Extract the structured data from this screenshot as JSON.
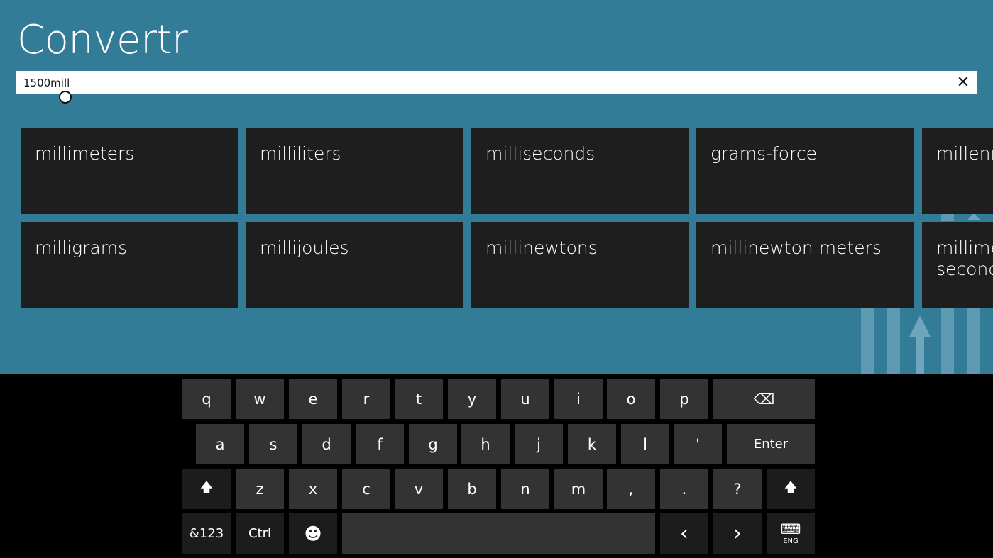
{
  "app": {
    "title": "Convertr",
    "search": {
      "value": "1500mill",
      "placeholder": ""
    },
    "clear_icon": "close-icon",
    "suggestions": [
      "millimeters",
      "milliliters",
      "milliseconds",
      "grams-force",
      "millennia",
      "milligrams",
      "millijoules",
      "millinewtons",
      "millinewton meters",
      "millimeters per second"
    ]
  },
  "keyboard": {
    "row1": [
      "q",
      "w",
      "e",
      "r",
      "t",
      "y",
      "u",
      "i",
      "o",
      "p"
    ],
    "row2": [
      "a",
      "s",
      "d",
      "f",
      "g",
      "h",
      "j",
      "k",
      "l",
      "'"
    ],
    "row3": [
      "z",
      "x",
      "c",
      "v",
      "b",
      "n",
      "m",
      ",",
      ".",
      "?"
    ],
    "enter_label": "Enter",
    "symbols_label": "&123",
    "ctrl_label": "Ctrl",
    "lang_label": "ENG",
    "shift_glyph": "🡅",
    "backspace_glyph": "⌫",
    "emoji_glyph": "☻",
    "left_glyph": "‹",
    "right_glyph": "›",
    "keyboard_glyph": "⌨"
  },
  "colors": {
    "background": "#327c97",
    "tile": "#1e1e1e",
    "key": "#333333",
    "keyboard_bg": "#000000"
  }
}
